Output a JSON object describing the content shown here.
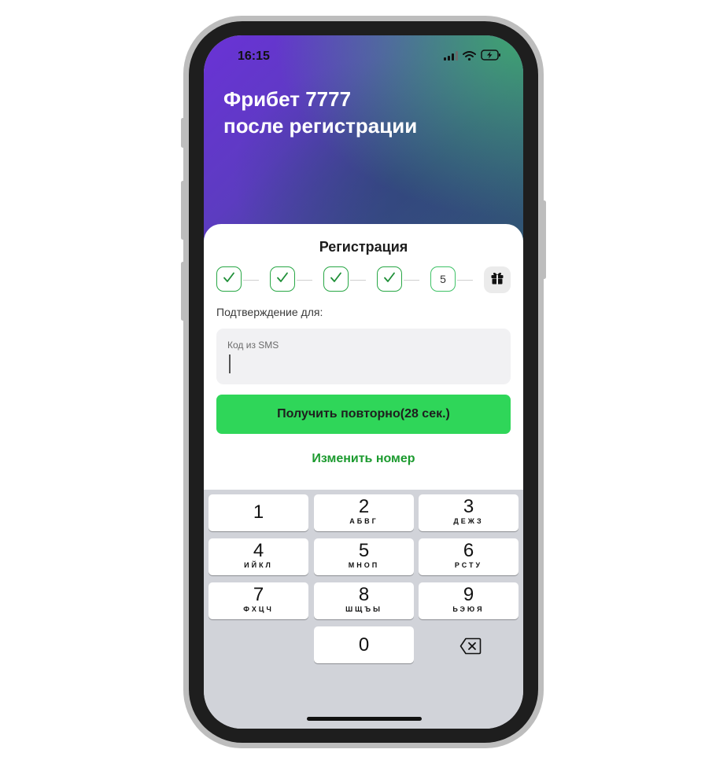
{
  "status_bar": {
    "time": "16:15"
  },
  "hero": {
    "title_line1": "Фрибет 7777",
    "title_line2": "после регистрации"
  },
  "sheet": {
    "title": "Регистрация",
    "steps": [
      {
        "state": "done",
        "icon": "check-icon"
      },
      {
        "state": "done",
        "icon": "check-icon"
      },
      {
        "state": "done",
        "icon": "check-icon"
      },
      {
        "state": "done",
        "icon": "check-icon"
      },
      {
        "state": "current",
        "label": "5"
      },
      {
        "state": "reward",
        "icon": "gift-icon"
      }
    ],
    "confirm_label": "Подтверждение для:",
    "code_field": {
      "label": "Код из SMS",
      "value": ""
    },
    "resend_button": "Получить повторно(28 сек.)",
    "change_number": "Изменить номер"
  },
  "keyboard": {
    "keys": [
      {
        "digit": "1",
        "letters": ""
      },
      {
        "digit": "2",
        "letters": "АБВГ"
      },
      {
        "digit": "3",
        "letters": "ДЕЖЗ"
      },
      {
        "digit": "4",
        "letters": "ИЙКЛ"
      },
      {
        "digit": "5",
        "letters": "МНОП"
      },
      {
        "digit": "6",
        "letters": "РСТУ"
      },
      {
        "digit": "7",
        "letters": "ФХЦЧ"
      },
      {
        "digit": "8",
        "letters": "ШЩЪЫ"
      },
      {
        "digit": "9",
        "letters": "ЬЭЮЯ"
      },
      {
        "digit": "0",
        "letters": ""
      }
    ],
    "delete_icon": "backspace-icon"
  },
  "colors": {
    "accent_green": "#2fd659",
    "link_green": "#1b9a2e",
    "step_green": "#28a745"
  }
}
